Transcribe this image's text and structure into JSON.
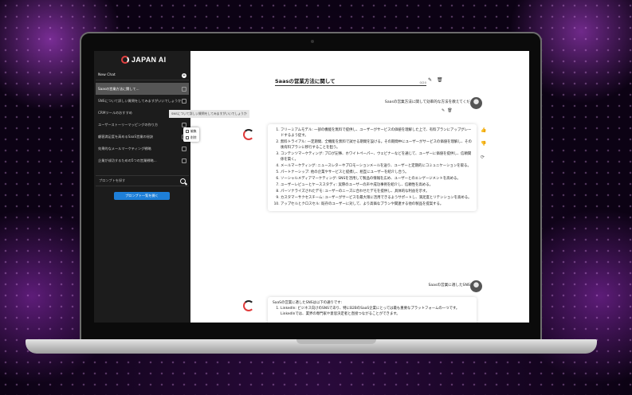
{
  "brand": {
    "name": "JAPAN AI"
  },
  "sidebar": {
    "new_chat_label": "New Chat",
    "items": [
      {
        "label": "Saasの営業方法に関して..."
      },
      {
        "label": "SNSについて詳しい質問をしてみますがいいでしょうか"
      },
      {
        "label": "CRMツールのおすすめ"
      },
      {
        "label": "ユーザーストーリーマッピングの作り方"
      },
      {
        "label": "顧客満足度を高めるSaaS営業の秘訣"
      },
      {
        "label": "効果的なメールマーケティング戦略"
      },
      {
        "label": "企業が成功するための5つの営業戦略..."
      }
    ],
    "tooltip": "SNSについて詳しい質問をしてみますがいいでしょうか",
    "context_menu": {
      "edit": "編集",
      "delete": "削除"
    },
    "prompt_search_placeholder": "プロンプトを探す",
    "prompt_button": "プロンプト一覧を開く"
  },
  "chat": {
    "title": "Saasの営業方法に関して",
    "title_count": "0/20",
    "messages": [
      {
        "role": "user",
        "text": "Saasの営業方法に関して効率的な方法を教えてください"
      },
      {
        "role": "assistant",
        "items": [
          "フリーミアムモデル: 一部の機能を無料で提供し、ユーザーがサービスの価値を理解した上で、有料プランにアップグレードするよう促す。",
          "無料トライアル: 一定期間、全機能を無料で試せる期間を設ける。その期間中にユーザーがサービスの価値を理解し、その後有料プランに移行することを狙う。",
          "コンテンツマーケティング: ブログ記事、ホワイトペーパー、ウェビナーなどを通じて、ユーザーに価値を提供し、信頼関係を築く。",
          "メールマーケティング: ニュースレターやプロモーションメールを送り、ユーザーと定期的にコミュニケーションを取る。",
          "パートナーシップ: 他の企業やサービスと提携し、相互にユーザーを紹介し合う。",
          "ソーシャルメディアマーケティング: SNSを活用して製品の情報を広め、ユーザーとのエンゲージメントを高める。",
          "ユーザーレビューとケーススタディ: 実際のユーザーの声や成功事例を紹介し、信頼性を高める。",
          "パーソナライズされたデモ: ユーザーのニーズに合わせたデモを提供し、具体的な利益を示す。",
          "カスタマーサクセスチーム: ユーザーがサービスを最大限に活用できるようサポートし、満足度とリテンションを高める。",
          "アップセルとクロスセル: 既存のユーザーに対して、より高価なプランや関連する他の製品を提案する。"
        ]
      },
      {
        "role": "user",
        "text": "Saasの営業に適したSNSは？"
      },
      {
        "role": "assistant",
        "intro": "SaaSの営業に適したSNSは以下の通りです:",
        "items": [
          "LinkedIn: ビジネス向けのSNSであり、特にB2BのSaaS企業にとっては最も重要なプラットフォームの一つです。LinkedInでは、業界の専門家や意思決定者と直接つながることができます。"
        ]
      }
    ],
    "icons": {
      "edit": "edit-icon",
      "delete": "trash-icon",
      "like": "thumbs-up-icon",
      "dislike": "thumbs-down-icon",
      "regenerate": "refresh-icon"
    }
  },
  "colors": {
    "accent": "#1e7fd8",
    "sidebar_bg": "#1c1c1c",
    "brand_red": "#e03a3a"
  }
}
